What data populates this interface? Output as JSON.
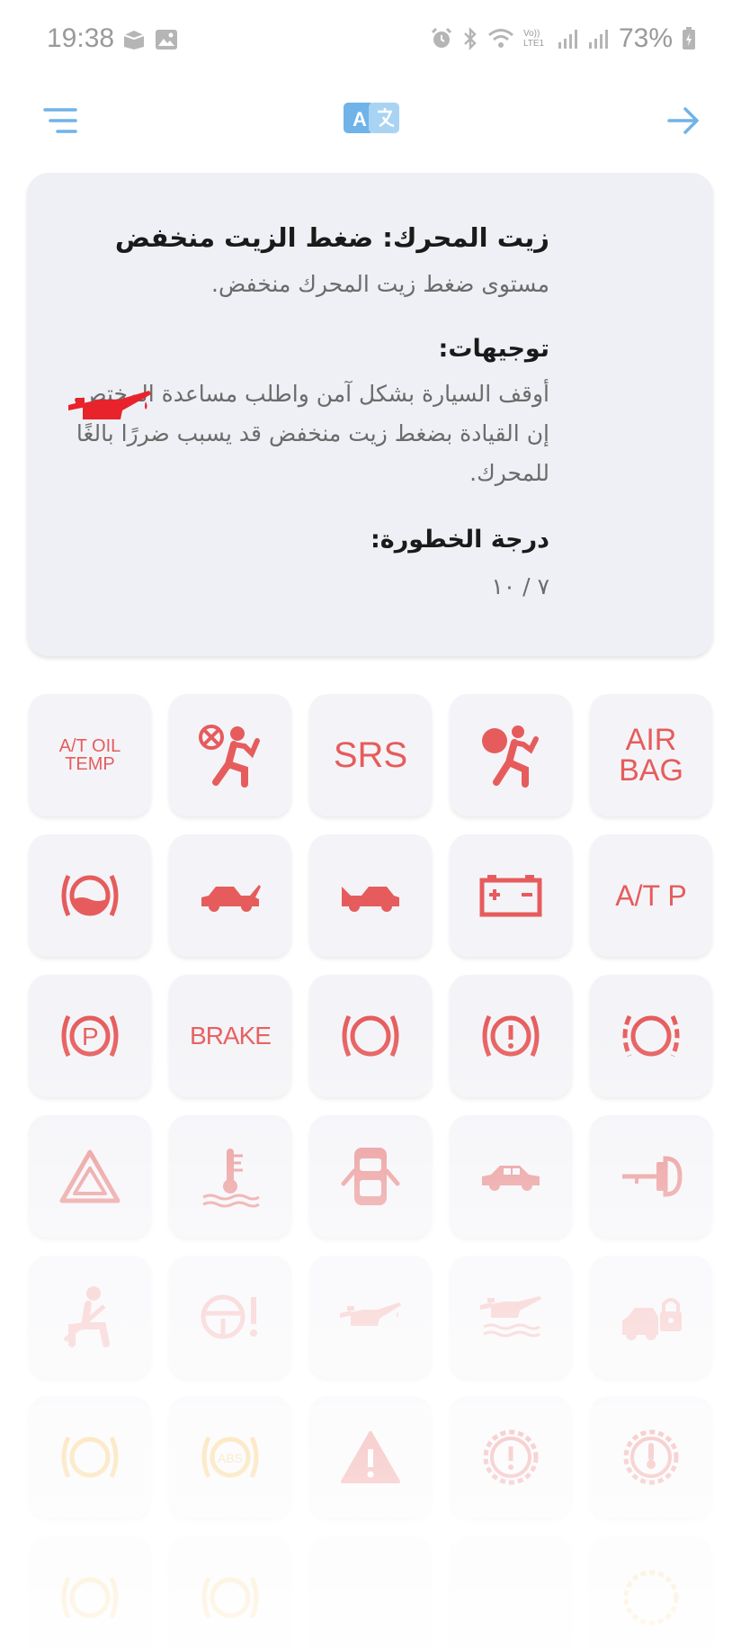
{
  "status_bar": {
    "time": "19:38",
    "battery": "73%",
    "network_label": "Vo)) LTE1"
  },
  "top_bar": {
    "menu_icon": "filter-menu-icon",
    "translate_icon": "translate-icon",
    "forward_icon": "arrow-right-icon",
    "accent_color": "#6fb3e8"
  },
  "card": {
    "title": "زيت المحرك: ضغط الزيت منخفض",
    "description": "مستوى ضغط زيت المحرك منخفض.",
    "instructions_heading": "توجيهات:",
    "instructions_text": "أوقف السيارة بشكل آمن واطلب مساعدة المختص. إن القيادة بضغط زيت منخفض قد يسبب ضررًا بالغًا للمحرك.",
    "severity_heading": "درجة الخطورة:",
    "severity_value": "٧ / ١٠",
    "icon": "oil-pressure-icon",
    "icon_color": "#e8232b"
  },
  "grid": {
    "accent_color": "#e65c5c",
    "warning_color": "#f4b33a",
    "tiles": [
      {
        "id": "at-oil-temp",
        "icon": "text",
        "text": "A/T OIL TEMP"
      },
      {
        "id": "airbag-off",
        "icon": "airbag-off-icon"
      },
      {
        "id": "srs",
        "icon": "text",
        "text": "SRS"
      },
      {
        "id": "airbag",
        "icon": "airbag-icon"
      },
      {
        "id": "air-bag-text",
        "icon": "text",
        "text": "AIR BAG"
      },
      {
        "id": "brake-fluid",
        "icon": "brake-fluid-icon"
      },
      {
        "id": "trunk-open",
        "icon": "trunk-open-icon"
      },
      {
        "id": "hood-open",
        "icon": "hood-open-icon"
      },
      {
        "id": "battery",
        "icon": "battery-icon"
      },
      {
        "id": "at-p",
        "icon": "text",
        "text": "A/T P"
      },
      {
        "id": "parking-brake",
        "icon": "parking-brake-icon"
      },
      {
        "id": "brake-text",
        "icon": "text",
        "text": "BRAKE"
      },
      {
        "id": "brake-circle",
        "icon": "brake-circle-icon"
      },
      {
        "id": "brake-warning",
        "icon": "brake-warning-icon"
      },
      {
        "id": "brake-pad",
        "icon": "brake-pad-icon"
      },
      {
        "id": "hazard",
        "icon": "hazard-triangle-icon"
      },
      {
        "id": "coolant-temp",
        "icon": "coolant-temp-icon"
      },
      {
        "id": "door-open",
        "icon": "door-open-icon"
      },
      {
        "id": "car-side",
        "icon": "car-side-icon"
      },
      {
        "id": "key",
        "icon": "key-icon"
      },
      {
        "id": "seatbelt",
        "icon": "seatbelt-icon"
      },
      {
        "id": "steering-warning",
        "icon": "steering-warning-icon"
      },
      {
        "id": "oil-can",
        "icon": "oil-can-icon"
      },
      {
        "id": "oil-level",
        "icon": "oil-level-icon"
      },
      {
        "id": "car-lock",
        "icon": "car-lock-icon"
      },
      {
        "id": "brake-yellow",
        "icon": "brake-circle-yellow-icon"
      },
      {
        "id": "abs",
        "icon": "abs-icon"
      },
      {
        "id": "general-warning",
        "icon": "warning-triangle-icon"
      },
      {
        "id": "gear-warning",
        "icon": "gear-exclamation-icon"
      },
      {
        "id": "gear-temp",
        "icon": "gear-temp-icon"
      },
      {
        "id": "row7-1",
        "icon": "brake-circle-yellow-icon"
      },
      {
        "id": "row7-2",
        "icon": "steering-circle-icon"
      },
      {
        "id": "row7-3",
        "icon": "blank"
      },
      {
        "id": "row7-4",
        "icon": "blank"
      },
      {
        "id": "row7-5",
        "icon": "gear-circle-icon"
      }
    ]
  }
}
